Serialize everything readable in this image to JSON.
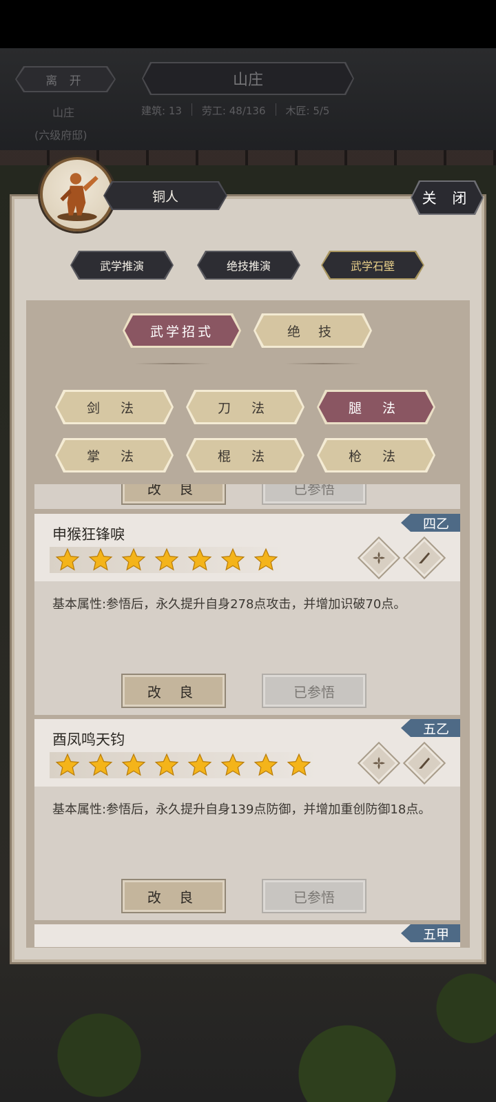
{
  "header": {
    "leave_label": "离 开",
    "title": "山庄",
    "sub1": "山庄",
    "sub2": "(六级府邸)",
    "stats": [
      "建筑: 13",
      "劳工: 48/136",
      "木匠: 5/5"
    ]
  },
  "dialog": {
    "name": "铜人",
    "close_label": "关 闭",
    "top_tabs": [
      "武学推演",
      "绝技推演",
      "武学石壁"
    ],
    "segments": [
      "武学招式",
      "绝 技"
    ],
    "categories": [
      "剑 法",
      "刀 法",
      "腿 法",
      "掌 法",
      "棍 法",
      "枪 法"
    ]
  },
  "partial_top": {
    "improve": "改 良",
    "done": "已参悟"
  },
  "cards": [
    {
      "name": "申猴狂锋唳",
      "grade": "四乙",
      "stars": 7,
      "desc": "基本属性:参悟后，永久提升自身278点攻击，并增加识破70点。",
      "improve": "改 良",
      "done": "已参悟"
    },
    {
      "name": "酉凤鸣天钧",
      "grade": "五乙",
      "stars": 8,
      "desc": "基本属性:参悟后，永久提升自身139点防御，并增加重创防御18点。",
      "improve": "改 良",
      "done": "已参悟"
    },
    {
      "grade": "五甲"
    }
  ],
  "icons": {
    "portrait": "bronze-figure-icon",
    "attr": "flower-icon",
    "weapon": "blade-icon",
    "star": "star-icon"
  },
  "colors": {
    "active_tab": "#8a5662",
    "grade_badge": "#4e6a86",
    "star": "#f4b41a"
  }
}
